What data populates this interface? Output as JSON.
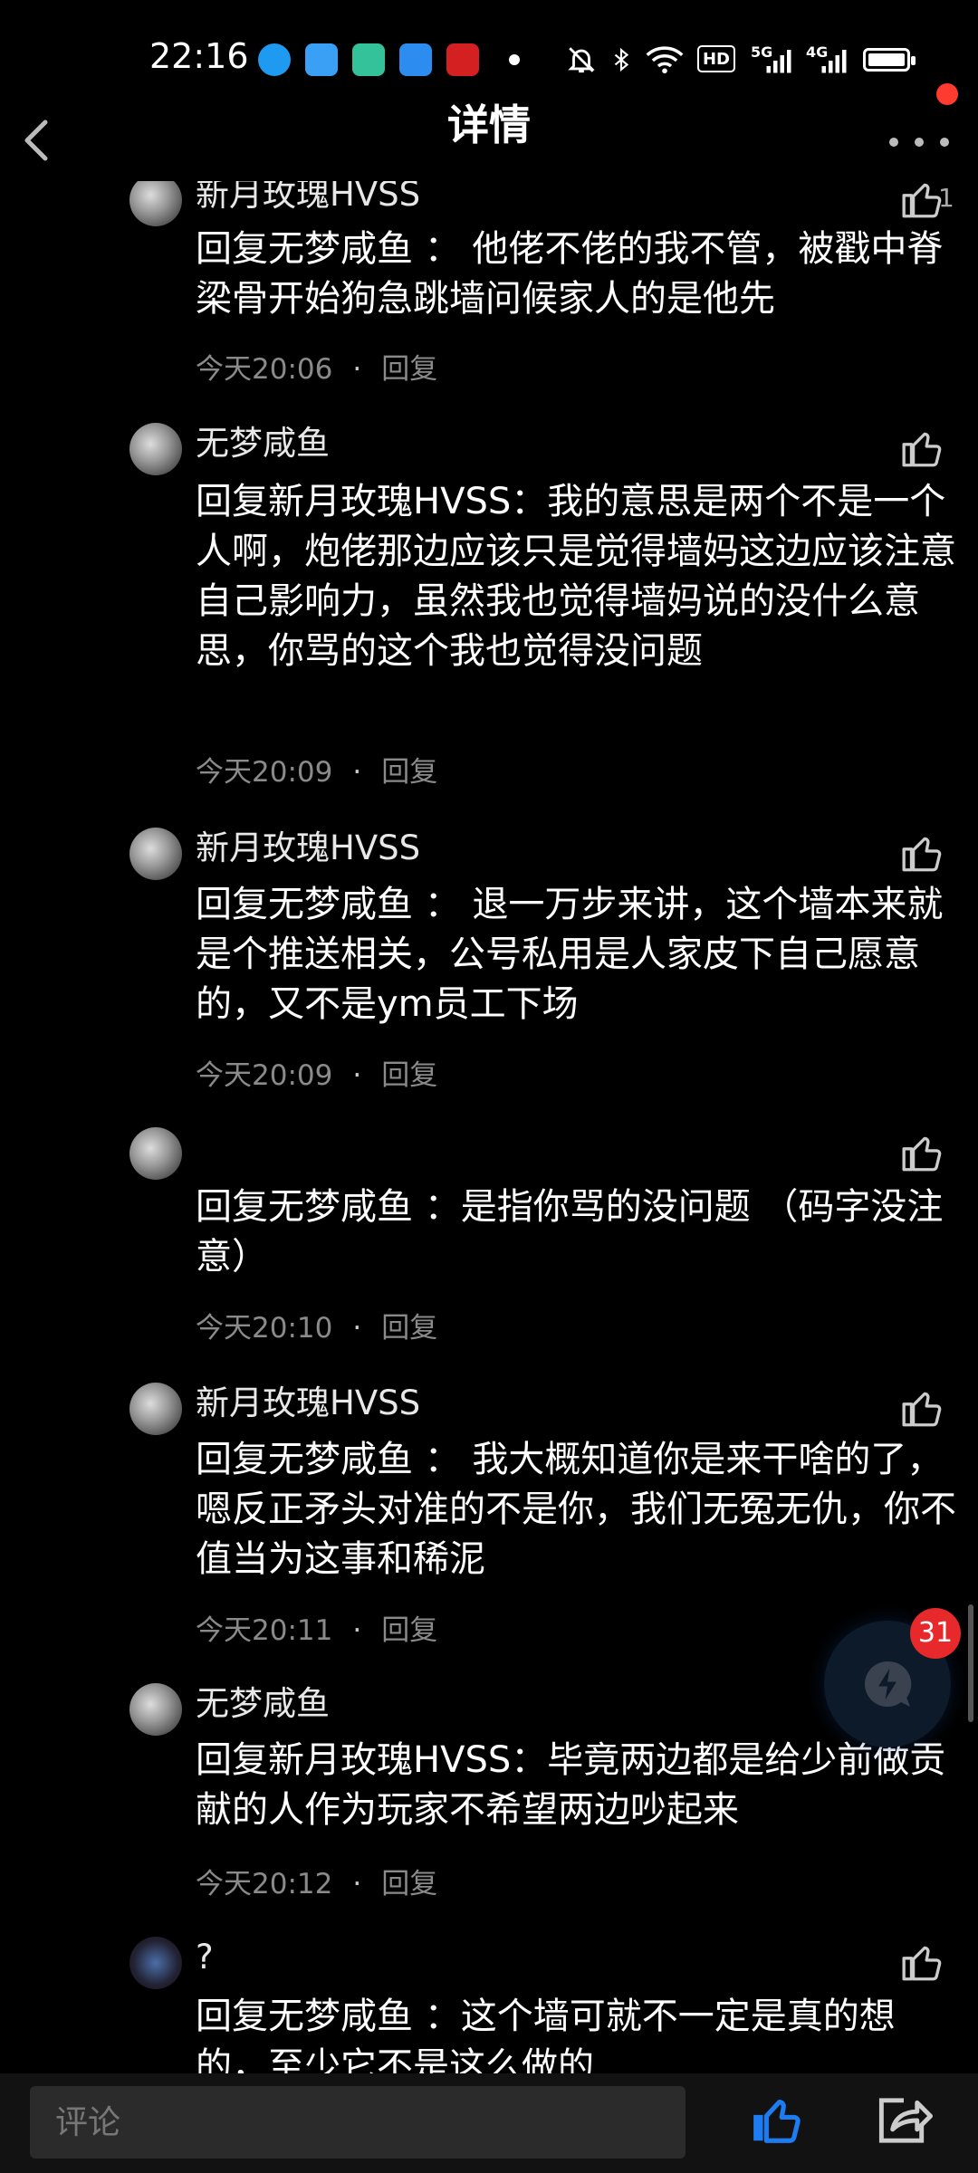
{
  "status_bar": {
    "time": "22:16",
    "signal_5g": "5G",
    "signal_4g": "4G",
    "hd_badge": "HD"
  },
  "header": {
    "title": "详情"
  },
  "comments": [
    {
      "username": "新月玫瑰HVSS",
      "text": "回复无梦咸鱼 ：  他佬不佬的我不管，被戳中脊梁骨开始狗急跳墙问候家人的是他先",
      "time": "今天20:06",
      "reply_label": "回复",
      "likes": "1"
    },
    {
      "username": "无梦咸鱼",
      "text": "回复新月玫瑰HVSS：我的意思是两个不是一个人啊，炮佬那边应该只是觉得墙妈这边应该注意自己影响力，虽然我也觉得墙妈说的没什么意思，你骂的这个我也觉得没问题",
      "time": "今天20:09",
      "reply_label": "回复"
    },
    {
      "username": "新月玫瑰HVSS",
      "text": "回复无梦咸鱼 ：  退一万步来讲，这个墙本来就是个推送相关，公号私用是人家皮下自己愿意的，又不是ym员工下场",
      "time": "今天20:09",
      "reply_label": "回复"
    },
    {
      "username": "",
      "text": "回复无梦咸鱼 ：是指你骂的没问题      （码字没注意）",
      "time": "今天20:10",
      "reply_label": "回复"
    },
    {
      "username": "新月玫瑰HVSS",
      "text": "回复无梦咸鱼 ：  我大概知道你是来干啥的了，嗯反正矛头对准的不是你，我们无冤无仇，你不值当为这事和稀泥",
      "time": "今天20:11",
      "reply_label": "回复"
    },
    {
      "username": "无梦咸鱼",
      "text": "回复新月玫瑰HVSS：毕竟两边都是给少前做贡献的人作为玩家不希望两边吵起来",
      "time": "今天20:12",
      "reply_label": "回复"
    },
    {
      "username": "?",
      "text": "回复无梦咸鱼 ：这个墙可就不一定是真的想的，至少它不是这么做的"
    }
  ],
  "fab": {
    "badge": "31"
  },
  "bottom_bar": {
    "input_placeholder": "评论"
  },
  "colors": {
    "background": "#000000",
    "like_active": "#1e7cf2",
    "badge_red": "#e8292b"
  }
}
